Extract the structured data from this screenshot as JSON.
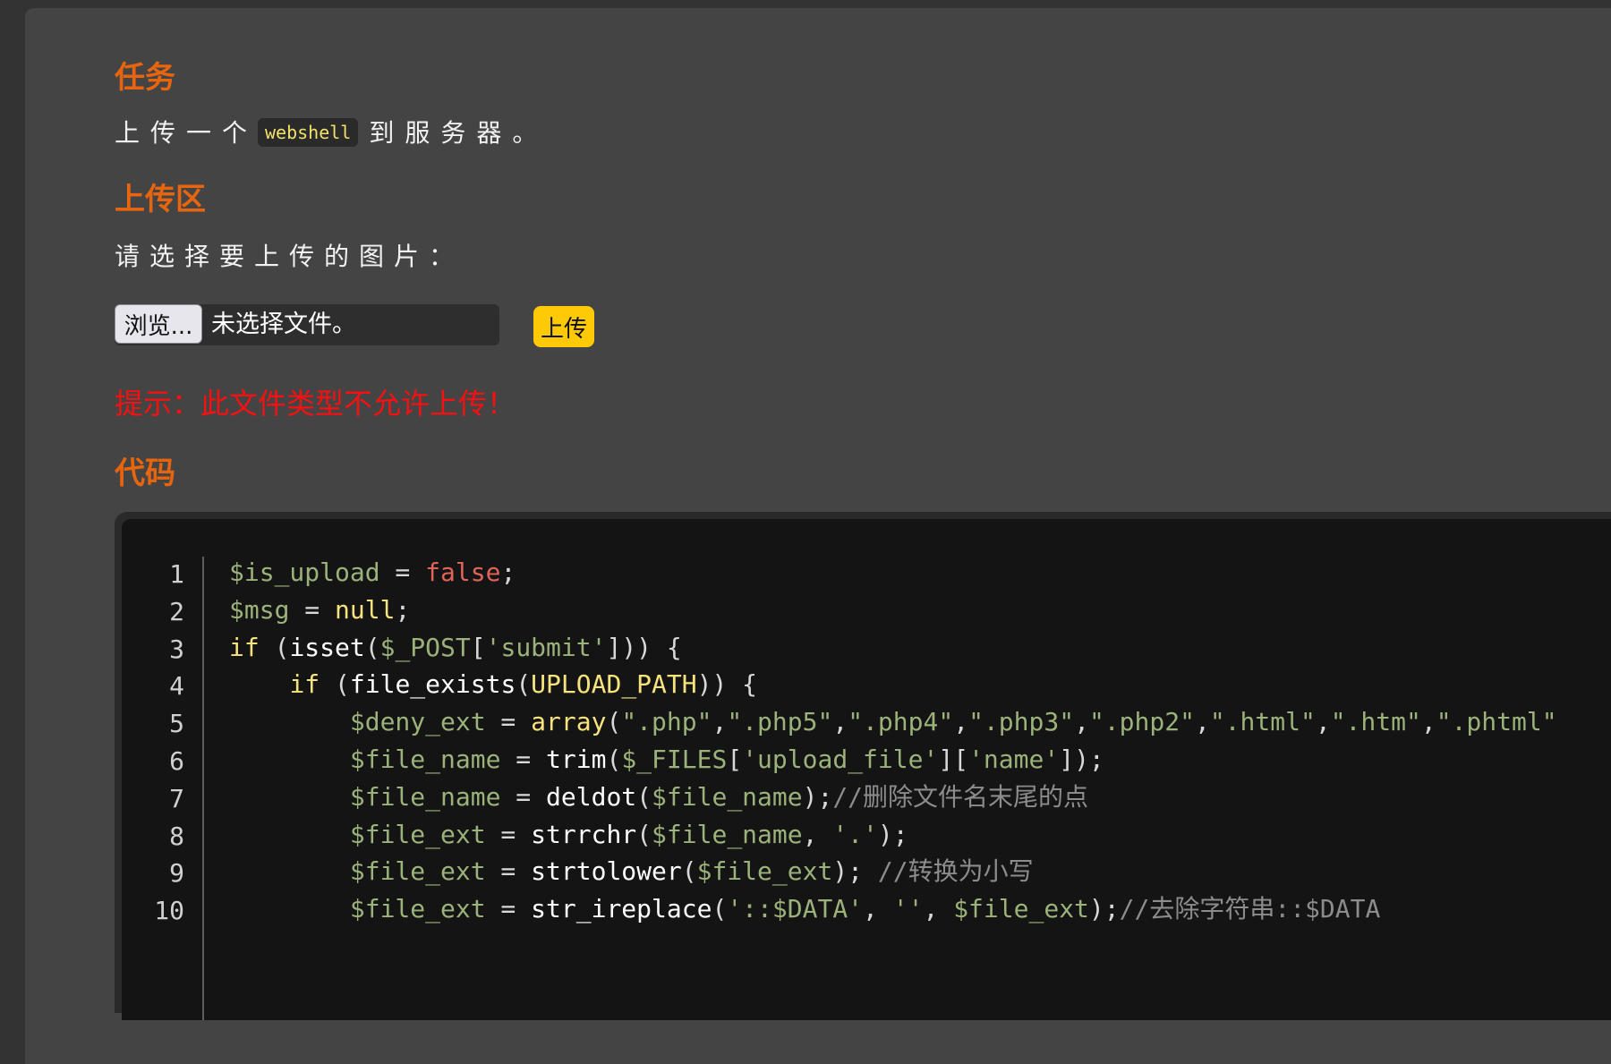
{
  "task": {
    "heading": "任务",
    "text_before": "上传一个",
    "code_word": "webshell",
    "text_after": "到服务器。"
  },
  "upload_area": {
    "heading": "上传区",
    "prompt": "请选择要上传的图片：",
    "browse_label": "浏览...",
    "file_status": "未选择文件。",
    "upload_label": "上传",
    "hint": "提示：此文件类型不允许上传！"
  },
  "code_section": {
    "heading": "代码",
    "line_numbers": [
      "1",
      "2",
      "3",
      "4",
      "5",
      "6",
      "7",
      "8",
      "9",
      "10"
    ],
    "lines": [
      [
        [
          "v",
          "$is_upload"
        ],
        [
          "p",
          " = "
        ],
        [
          "b",
          "false"
        ],
        [
          "p",
          ";"
        ]
      ],
      [
        [
          "v",
          "$msg"
        ],
        [
          "p",
          " = "
        ],
        [
          "k",
          "null"
        ],
        [
          "p",
          ";"
        ]
      ],
      [
        [
          "k",
          "if"
        ],
        [
          "p",
          " ("
        ],
        [
          "f",
          "isset"
        ],
        [
          "p",
          "("
        ],
        [
          "v",
          "$_POST"
        ],
        [
          "p",
          "["
        ],
        [
          "s",
          "'submit'"
        ],
        [
          "p",
          "])) {"
        ]
      ],
      [
        [
          "p",
          "    "
        ],
        [
          "k",
          "if"
        ],
        [
          "p",
          " ("
        ],
        [
          "f",
          "file_exists"
        ],
        [
          "p",
          "("
        ],
        [
          "k",
          "UPLOAD_PATH"
        ],
        [
          "p",
          ")) {"
        ]
      ],
      [
        [
          "p",
          "        "
        ],
        [
          "v",
          "$deny_ext"
        ],
        [
          "p",
          " = "
        ],
        [
          "k",
          "array"
        ],
        [
          "p",
          "("
        ],
        [
          "s",
          "\".php\""
        ],
        [
          "p",
          ","
        ],
        [
          "s",
          "\".php5\""
        ],
        [
          "p",
          ","
        ],
        [
          "s",
          "\".php4\""
        ],
        [
          "p",
          ","
        ],
        [
          "s",
          "\".php3\""
        ],
        [
          "p",
          ","
        ],
        [
          "s",
          "\".php2\""
        ],
        [
          "p",
          ","
        ],
        [
          "s",
          "\".html\""
        ],
        [
          "p",
          ","
        ],
        [
          "s",
          "\".htm\""
        ],
        [
          "p",
          ","
        ],
        [
          "s",
          "\".phtml\""
        ]
      ],
      [
        [
          "p",
          "        "
        ],
        [
          "v",
          "$file_name"
        ],
        [
          "p",
          " = "
        ],
        [
          "f",
          "trim"
        ],
        [
          "p",
          "("
        ],
        [
          "v",
          "$_FILES"
        ],
        [
          "p",
          "["
        ],
        [
          "s",
          "'upload_file'"
        ],
        [
          "p",
          "]["
        ],
        [
          "s",
          "'name'"
        ],
        [
          "p",
          "]);"
        ]
      ],
      [
        [
          "p",
          "        "
        ],
        [
          "v",
          "$file_name"
        ],
        [
          "p",
          " = "
        ],
        [
          "f",
          "deldot"
        ],
        [
          "p",
          "("
        ],
        [
          "v",
          "$file_name"
        ],
        [
          "p",
          ");"
        ],
        [
          "c",
          "//删除文件名末尾的点"
        ]
      ],
      [
        [
          "p",
          "        "
        ],
        [
          "v",
          "$file_ext"
        ],
        [
          "p",
          " = "
        ],
        [
          "f",
          "strrchr"
        ],
        [
          "p",
          "("
        ],
        [
          "v",
          "$file_name"
        ],
        [
          "p",
          ", "
        ],
        [
          "s",
          "'.'"
        ],
        [
          "p",
          ");"
        ]
      ],
      [
        [
          "p",
          "        "
        ],
        [
          "v",
          "$file_ext"
        ],
        [
          "p",
          " = "
        ],
        [
          "f",
          "strtolower"
        ],
        [
          "p",
          "("
        ],
        [
          "v",
          "$file_ext"
        ],
        [
          "p",
          "); "
        ],
        [
          "c",
          "//转换为小写"
        ]
      ],
      [
        [
          "p",
          "        "
        ],
        [
          "v",
          "$file_ext"
        ],
        [
          "p",
          " = "
        ],
        [
          "f",
          "str_ireplace"
        ],
        [
          "p",
          "("
        ],
        [
          "s",
          "'::$DATA'"
        ],
        [
          "p",
          ", "
        ],
        [
          "s",
          "''"
        ],
        [
          "p",
          ", "
        ],
        [
          "v",
          "$file_ext"
        ],
        [
          "p",
          ");"
        ],
        [
          "c",
          "//去除字符串::$DATA"
        ]
      ]
    ]
  },
  "colors": {
    "heading": "#e8650f",
    "hint": "#f51111",
    "upload_button": "#fec907",
    "inline_code": "#f3e16a"
  }
}
